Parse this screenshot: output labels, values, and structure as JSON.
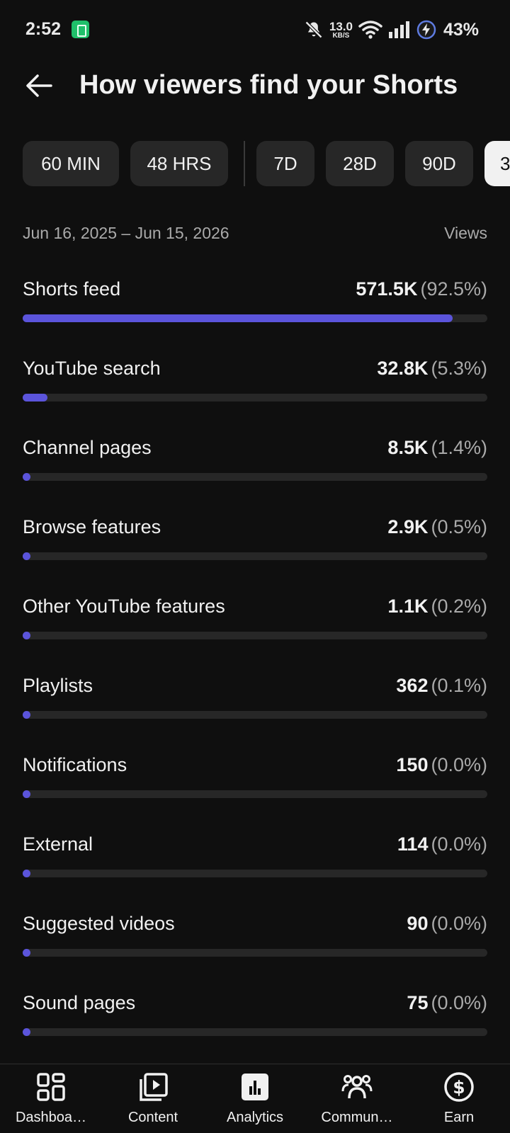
{
  "status_bar": {
    "time": "2:52",
    "net_speed_value": "13.0",
    "net_speed_unit": "KB/S",
    "battery_percent": "43%"
  },
  "header": {
    "title": "How viewers find your Shorts"
  },
  "chips": [
    {
      "label": "60 MIN",
      "selected": false
    },
    {
      "label": "48 HRS",
      "selected": false
    },
    {
      "label": "7D",
      "selected": false
    },
    {
      "label": "28D",
      "selected": false
    },
    {
      "label": "90D",
      "selected": false
    },
    {
      "label": "3",
      "selected": true
    }
  ],
  "date_range": "Jun 16, 2025 – Jun 15, 2026",
  "metric_label": "Views",
  "sources": [
    {
      "label": "Shorts feed",
      "views": "571.5K",
      "percent": "(92.5%)",
      "share": 0.925
    },
    {
      "label": "YouTube search",
      "views": "32.8K",
      "percent": "(5.3%)",
      "share": 0.053
    },
    {
      "label": "Channel pages",
      "views": "8.5K",
      "percent": "(1.4%)",
      "share": 0.014
    },
    {
      "label": "Browse features",
      "views": "2.9K",
      "percent": "(0.5%)",
      "share": 0.005
    },
    {
      "label": "Other YouTube features",
      "views": "1.1K",
      "percent": "(0.2%)",
      "share": 0.002
    },
    {
      "label": "Playlists",
      "views": "362",
      "percent": "(0.1%)",
      "share": 0.001
    },
    {
      "label": "Notifications",
      "views": "150",
      "percent": "(0.0%)",
      "share": 0.0
    },
    {
      "label": "External",
      "views": "114",
      "percent": "(0.0%)",
      "share": 0.0
    },
    {
      "label": "Suggested videos",
      "views": "90",
      "percent": "(0.0%)",
      "share": 0.0
    },
    {
      "label": "Sound pages",
      "views": "75",
      "percent": "(0.0%)",
      "share": 0.0
    }
  ],
  "bottom_nav": [
    {
      "label": "Dashboa…",
      "icon": "dashboard-icon"
    },
    {
      "label": "Content",
      "icon": "content-icon"
    },
    {
      "label": "Analytics",
      "icon": "analytics-icon",
      "active": true
    },
    {
      "label": "Commun…",
      "icon": "community-icon"
    },
    {
      "label": "Earn",
      "icon": "earn-icon"
    }
  ],
  "colors": {
    "background": "#0f0f0f",
    "bar_fill": "#5b54db",
    "bar_track": "#272727",
    "chip_bg": "#272727"
  }
}
